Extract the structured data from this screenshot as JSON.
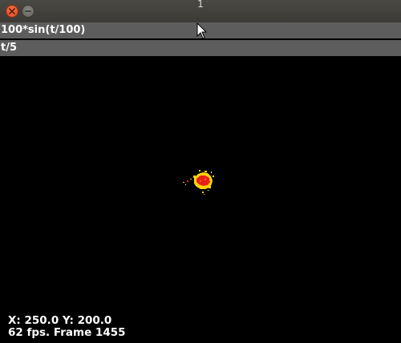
{
  "window": {
    "title": "1"
  },
  "expressions": {
    "x_expression": "100*sin(t/100)",
    "y_expression": "t/5"
  },
  "status": {
    "position_text": "X: 250.0 Y: 200.0",
    "fps_text": "62 fps. Frame 1455"
  },
  "colors": {
    "titlebar": "#3f3e3a",
    "close_button": "#e55b2c",
    "field_background": "#5d5d5d",
    "canvas_background": "#000000",
    "particle_core": "#e8201a",
    "particle_glow": "#ffd400"
  },
  "icons": {
    "close": "close-icon",
    "minimize": "minimize-icon",
    "cursor": "mouse-pointer-icon"
  }
}
